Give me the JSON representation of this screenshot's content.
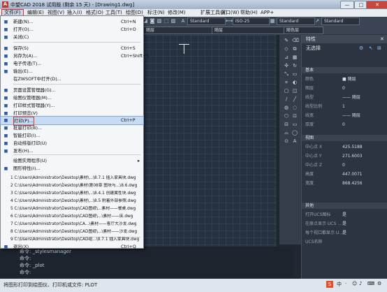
{
  "titlebar": {
    "logo": "A",
    "title": "中望CAD 2018 试用版 (剩余 15 天) - [Drawing1.dwg]",
    "btn_min": "—",
    "btn_max": "□",
    "btn_close": "✕"
  },
  "menubar": {
    "items": [
      "文件(F)",
      "编辑(E)",
      "视图(V)",
      "插入(I)",
      "格式(O)",
      "工具(T)",
      "绘图(D)",
      "标注(N)",
      "修改(M)",
      "扩展工具(X)",
      "窗口(W)",
      "帮助(H)",
      "APP+"
    ]
  },
  "toolbar1": {
    "text_style": "Standard",
    "dim_style": "ISO-25",
    "table_style": "Standard",
    "multileader_style": "Standard"
  },
  "toolbar2": {
    "linetype": "随层",
    "lineweight": "随层",
    "color": "随色层"
  },
  "file_menu": {
    "items": [
      {
        "label": "新建(N)...",
        "shortcut": "Ctrl+N",
        "icon": "new-file-icon"
      },
      {
        "label": "打开(O)...",
        "shortcut": "Ctrl+O",
        "icon": "open-folder-icon"
      },
      {
        "label": "关闭(C)",
        "shortcut": "",
        "icon": "close-doc-icon"
      },
      {
        "label": "保存(S)",
        "shortcut": "Ctrl+S",
        "icon": "save-icon"
      },
      {
        "label": "另存为(A)...",
        "shortcut": "Ctrl+Shift+S",
        "icon": "save-as-icon"
      },
      {
        "label": "电子传递(T)...",
        "shortcut": "",
        "icon": "etransmit-icon"
      },
      {
        "label": "输出(E)...",
        "shortcut": "",
        "icon": "export-icon"
      },
      {
        "label": "在ZWSOFT中打开(D)...",
        "shortcut": "",
        "icon": ""
      },
      {
        "label": "页面设置管理器(G)...",
        "shortcut": "",
        "icon": "page-setup-icon"
      },
      {
        "label": "绘图仪管理器(M)...",
        "shortcut": "",
        "icon": "plotter-icon"
      },
      {
        "label": "打印样式管理器(Y)...",
        "shortcut": "",
        "icon": "plot-style-icon"
      },
      {
        "label": "打印预览(V)",
        "shortcut": "",
        "icon": "preview-icon"
      },
      {
        "label": "打印(P)...",
        "shortcut": "Ctrl+P",
        "icon": "print-icon"
      },
      {
        "label": "批量打印(B)...",
        "shortcut": "",
        "icon": "batch-print-icon"
      },
      {
        "label": "智能打印(I)...",
        "shortcut": "",
        "icon": "smart-print-icon"
      },
      {
        "label": "自动排版打印(U)",
        "shortcut": "",
        "icon": "auto-layout-icon"
      },
      {
        "label": "发布(H)...",
        "shortcut": "",
        "icon": "publish-icon"
      },
      {
        "label": "绘图实用程序(U)",
        "shortcut": "",
        "icon": ""
      },
      {
        "label": "图形特性(I)...",
        "shortcut": "",
        "icon": "properties-icon"
      },
      {
        "label": "退出(X)",
        "shortcut": "Ctrl+Q",
        "icon": "exit-icon"
      }
    ],
    "recent": [
      "1 C:\\Users\\Administrator\\Desktop\\素材\\...\\8.7.1  插入家具块.dwg",
      "2 C:\\Users\\Administrator\\Desktop\\素材\\第08章 图块与...\\8.6.dwg",
      "3 C:\\Users\\Administrator\\Desktop\\素材\\...\\8.4.1  创建属性块.dwg",
      "4 C:\\Users\\Administrator\\Desktop\\素材\\...\\8.5  附着外部参照.dwg",
      "5 C:\\Users\\Administrator\\Desktop\\CAD图纸\\...素材——餐桌.dwg",
      "6 C:\\Users\\Administrator\\Desktop\\CAD图纸\\...\\素材——床.dwg",
      "7 C:\\Users\\Administrator\\Desktop\\CA...\\素材——客厅大沙发.dwg",
      "8 C:\\Users\\Administrator\\Desktop\\CAD图纸\\...\\素材——沙发.dwg",
      "9 C:\\Users\\Administrator\\Desktop\\CAD组...\\8.7.1  插入家具块.dwg"
    ]
  },
  "properties": {
    "title": "特性",
    "selection": "无选择",
    "sections": [
      {
        "name": "基本",
        "rows": [
          {
            "label": "颜色",
            "value": "■ 随层"
          },
          {
            "label": "图层",
            "value": "0"
          },
          {
            "label": "线型",
            "value": "—— 随层"
          },
          {
            "label": "线型比例",
            "value": "1"
          },
          {
            "label": "线宽",
            "value": "—— 随层"
          },
          {
            "label": "厚度",
            "value": "0"
          }
        ]
      },
      {
        "name": "视图",
        "rows": [
          {
            "label": "中心点 X",
            "value": "425.5188"
          },
          {
            "label": "中心点 Y",
            "value": "271.6003"
          },
          {
            "label": "中心点 Z",
            "value": "0"
          },
          {
            "label": "高度",
            "value": "447.0071"
          },
          {
            "label": "宽度",
            "value": "868.4256"
          }
        ]
      },
      {
        "name": "其他",
        "rows": [
          {
            "label": "打开UCS图标",
            "value": "是"
          },
          {
            "label": "在原点显示 UCS ...",
            "value": "是"
          },
          {
            "label": "每个视口都显示 U...",
            "value": "是"
          },
          {
            "label": "UCS名称",
            "value": ""
          }
        ]
      }
    ]
  },
  "command_history": [
    "命令: _stylesmanager",
    "命令:",
    "命令: _plot",
    "命令:"
  ],
  "command_prompt": "将图形打印到绘图仪、打印机或文件: PLOT"
}
